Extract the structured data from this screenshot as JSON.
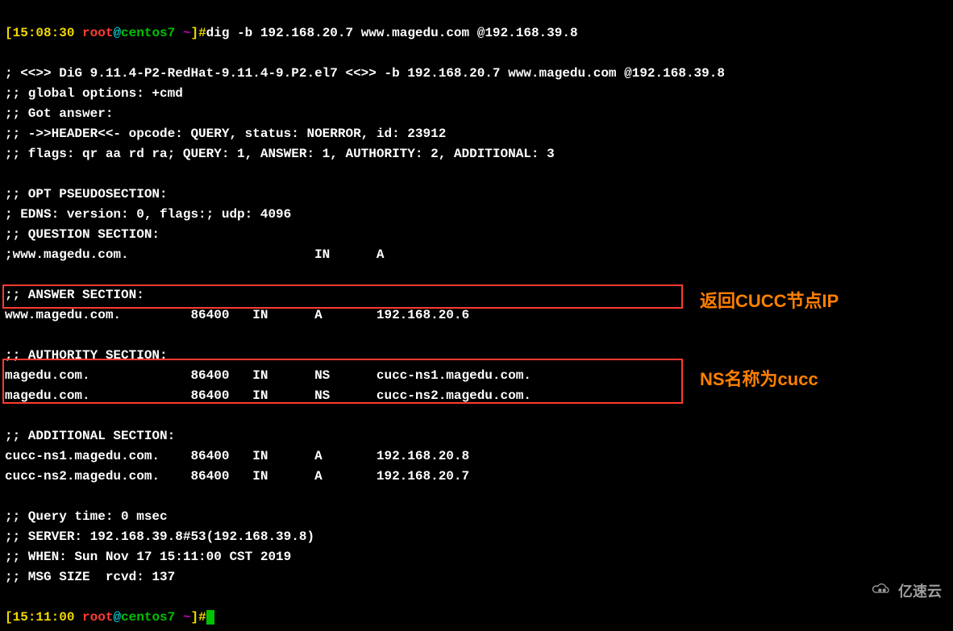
{
  "prompt1": {
    "time": "15:08:30",
    "user": "root",
    "at": "@",
    "host": "centos7",
    "path": " ~",
    "hash": "]#",
    "cmd": "dig -b 192.168.20.7 www.magedu.com @192.168.39.8"
  },
  "blank": "",
  "l_version": "; <<>> DiG 9.11.4-P2-RedHat-9.11.4-9.P2.el7 <<>> -b 192.168.20.7 www.magedu.com @192.168.39.8",
  "l_global": ";; global options: +cmd",
  "l_got": ";; Got answer:",
  "l_header": ";; ->>HEADER<<- opcode: QUERY, status: NOERROR, id: 23912",
  "l_flags": ";; flags: qr aa rd ra; QUERY: 1, ANSWER: 1, AUTHORITY: 2, ADDITIONAL: 3",
  "l_opt": ";; OPT PSEUDOSECTION:",
  "l_edns": "; EDNS: version: 0, flags:; udp: 4096",
  "l_qsec": ";; QUESTION SECTION:",
  "l_q": ";www.magedu.com.                        IN      A",
  "l_asec": ";; ANSWER SECTION:",
  "l_a": "www.magedu.com.         86400   IN      A       192.168.20.6",
  "l_authsec": ";; AUTHORITY SECTION:",
  "l_auth1": "magedu.com.             86400   IN      NS      cucc-ns1.magedu.com.",
  "l_auth2": "magedu.com.             86400   IN      NS      cucc-ns2.magedu.com.",
  "l_addsec": ";; ADDITIONAL SECTION:",
  "l_add1": "cucc-ns1.magedu.com.    86400   IN      A       192.168.20.8",
  "l_add2": "cucc-ns2.magedu.com.    86400   IN      A       192.168.20.7",
  "l_qt": ";; Query time: 0 msec",
  "l_srv": ";; SERVER: 192.168.39.8#53(192.168.39.8)",
  "l_when": ";; WHEN: Sun Nov 17 15:11:00 CST 2019",
  "l_msg": ";; MSG SIZE  rcvd: 137",
  "prompt2": {
    "time": "15:11:00",
    "user": "root",
    "at": "@",
    "host": "centos7",
    "path": " ~",
    "hash": "]#"
  },
  "annotations": {
    "cucc_ip": "返回CUCC节点IP",
    "ns_cucc": "NS名称为cucc"
  },
  "watermark": "亿速云",
  "colors": {
    "yellow": "#f2d800",
    "red": "#ff3b30",
    "cyan": "#00d0d0",
    "green": "#00c200",
    "purple": "#c000c0",
    "orange": "#ff8000"
  }
}
